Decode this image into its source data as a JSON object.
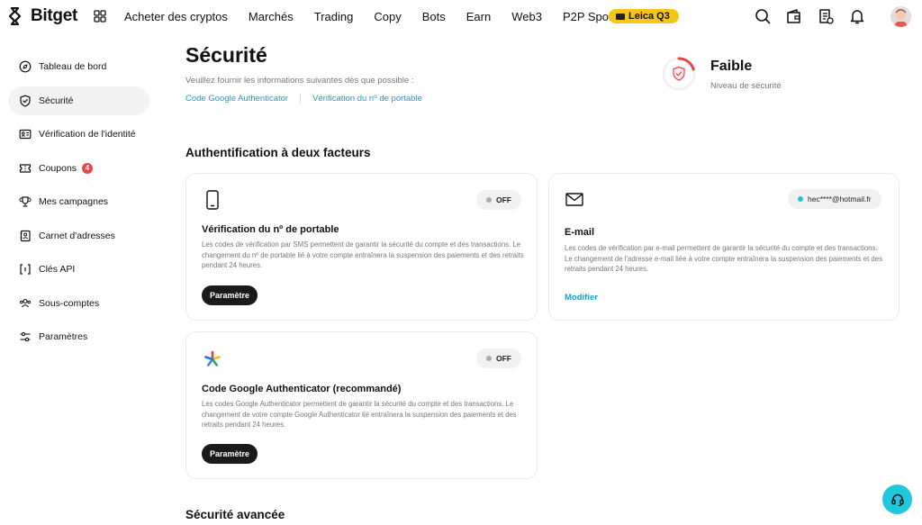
{
  "header": {
    "brand": "Bitget",
    "nav": [
      "Acheter des cryptos",
      "Marchés",
      "Trading",
      "Copy",
      "Bots",
      "Earn",
      "Web3",
      "P2P Spot"
    ],
    "promo": "Leica Q3"
  },
  "sidebar": {
    "items": [
      {
        "label": "Tableau de bord",
        "icon": "dashboard-icon"
      },
      {
        "label": "Sécurité",
        "icon": "shield-icon",
        "active": true
      },
      {
        "label": "Vérification de l'identité",
        "icon": "id-card-icon"
      },
      {
        "label": "Coupons",
        "icon": "coupon-icon",
        "badge": "4"
      },
      {
        "label": "Mes campagnes",
        "icon": "trophy-icon"
      },
      {
        "label": "Carnet d'adresses",
        "icon": "address-book-icon"
      },
      {
        "label": "Clés API",
        "icon": "api-key-icon"
      },
      {
        "label": "Sous-comptes",
        "icon": "sub-accounts-icon"
      },
      {
        "label": "Paramètres",
        "icon": "settings-sliders-icon"
      }
    ]
  },
  "main": {
    "title": "Sécurité",
    "subtitle": "Veuillez fournir les informations suivantes dès que possible :",
    "quick_links": [
      "Code Google Authenticator",
      "Vérification du nº de portable"
    ],
    "security_level": {
      "label": "Faible",
      "caption": "Niveau de sécurité"
    },
    "two_factor_title": "Authentification à deux facteurs",
    "advanced_title": "Sécurité avancée",
    "cards": {
      "phone": {
        "title": "Vérification du nº de portable",
        "description": "Les codes de vérification par SMS permettent de garantir la sécurité du compte et des transactions. Le changement du nº de portable lié à votre compte entraînera la suspension des paiements et des retraits pendant 24 heures.",
        "status": "OFF",
        "button": "Paramètre"
      },
      "email": {
        "title": "E-mail",
        "description": "Les codes de vérification par e-mail permettent de garantir la sécurité du compte et des transactions. Le changement de l'adresse e-mail liée à votre compte entraînera la suspension des paiements et des retraits pendant 24 heures.",
        "status": "hec****@hotmail.fr",
        "button": "Modifier"
      },
      "google": {
        "title": "Code Google Authenticator (recommandé)",
        "description": "Les codes Google Authenticator permettent de garantir la sécurité du compte et des transactions. Le changement de votre compte Google Authenticator lié entraînera la suspension des paiements et des retraits pendant 24 heures.",
        "status": "OFF",
        "button": "Paramètre"
      }
    }
  },
  "colors": {
    "accent": "#1a9ec7",
    "support": "#1fc8dc",
    "promo": "#f5c518",
    "warning": "#e34848"
  }
}
